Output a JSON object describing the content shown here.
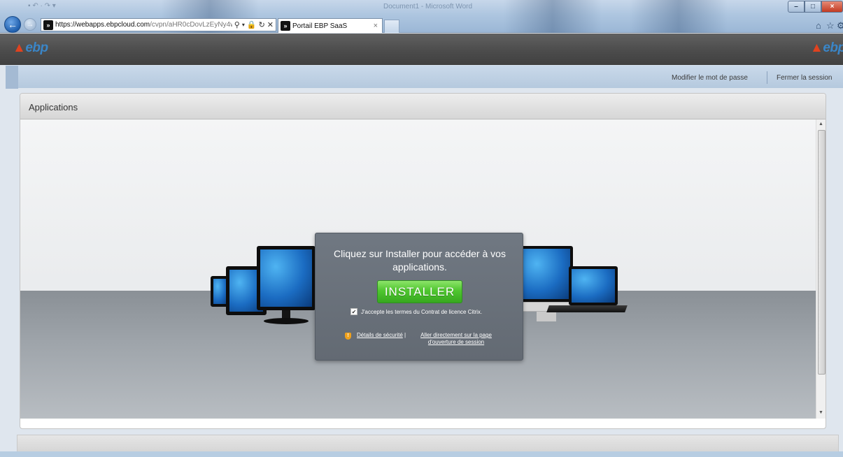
{
  "browser": {
    "title_text": "Document1 - Microsoft Word",
    "quick_access_glyphs": "▪ ↶ · ↷ ▾",
    "address": {
      "host": "https://webapps.ebpcloud.com",
      "path": "/cvpn/aHR0cDovLzEyNy4wLjA"
    },
    "tab_active": "Portail EBP SaaS",
    "tab_close": "×",
    "window_buttons": {
      "minimize": "–",
      "maximize": "□",
      "close": "×"
    },
    "icons": [
      "back-arrow-icon",
      "forward-arrow-icon",
      "search-icon",
      "lock-icon",
      "refresh-icon",
      "stop-icon",
      "home-icon",
      "favorites-star-icon",
      "citrix-favicon"
    ]
  },
  "ebp": {
    "logo_text": "ebp"
  },
  "user_bar": {
    "change_password": "Modifier le mot de passe",
    "logout": "Fermer la session"
  },
  "applications": {
    "title": "Applications"
  },
  "install_dialog": {
    "message": "Cliquez sur Installer pour accéder à vos applications.",
    "install_button": "INSTALLER",
    "license_checked": true,
    "license_text": "J'accepte les termes du Contrat de licence Citrix.",
    "security_details": "Détails de sécurité",
    "separator": "|",
    "direct_login": "Aller directement sur la page d'ouverture de session"
  },
  "colors": {
    "install_green": "#4fc62f",
    "ebp_blue": "#3a86c8",
    "ebp_red": "#e0421f",
    "header_dark": "#4c4c4c",
    "user_bar_blue": "#b5c9de",
    "dialog_gray": "#6a717a"
  }
}
